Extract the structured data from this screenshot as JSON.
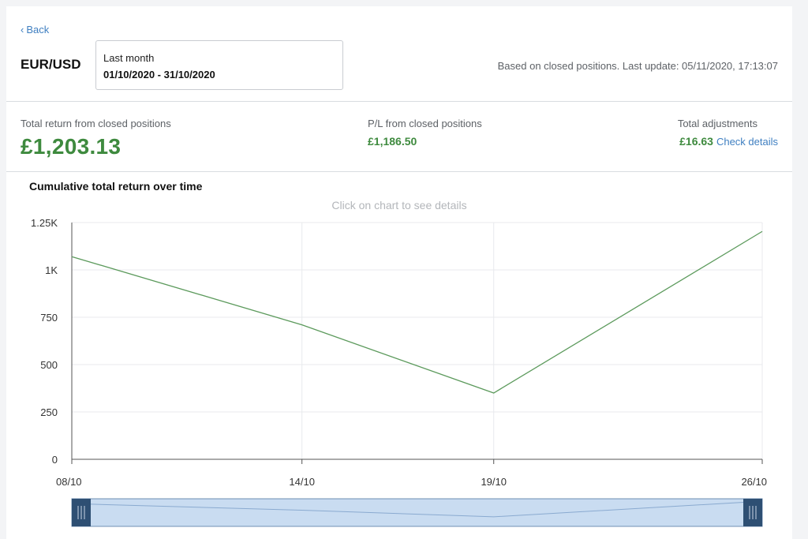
{
  "header": {
    "back_label": "Back",
    "pair": "EUR/USD",
    "date_range": {
      "label": "Last month",
      "value": "01/10/2020 - 31/10/2020"
    },
    "update_text": "Based on closed positions. Last update: 05/11/2020, 17:13:07"
  },
  "stats": {
    "total_return": {
      "label": "Total return from closed positions",
      "value": "£1,203.13"
    },
    "pl": {
      "label": "P/L from closed positions",
      "value": "£1,186.50"
    },
    "adjustments": {
      "label": "Total adjustments",
      "value": "£16.63",
      "link": "Check details"
    }
  },
  "chart": {
    "title": "Cumulative total return over time",
    "hint": "Click on chart to see details"
  },
  "colors": {
    "accent_green": "#3e8a3e",
    "link_blue": "#3f7fc1",
    "line": "#5c9a5c",
    "navigator_fill": "#c9dcf1",
    "navigator_handle": "#2e4f73"
  },
  "chart_data": {
    "type": "line",
    "x": [
      "08/10",
      "14/10",
      "19/10",
      "26/10"
    ],
    "x_days": [
      8,
      14,
      19,
      26
    ],
    "series": [
      {
        "values": [
          1070,
          710,
          350,
          1203.13
        ]
      }
    ],
    "ylim": [
      0,
      1250
    ],
    "yticks": [
      0,
      250,
      500,
      750,
      1000,
      1250
    ],
    "ytick_labels": [
      "0",
      "250",
      "500",
      "750",
      "1K",
      "1.25K"
    ],
    "grid": true,
    "legend": "none"
  }
}
